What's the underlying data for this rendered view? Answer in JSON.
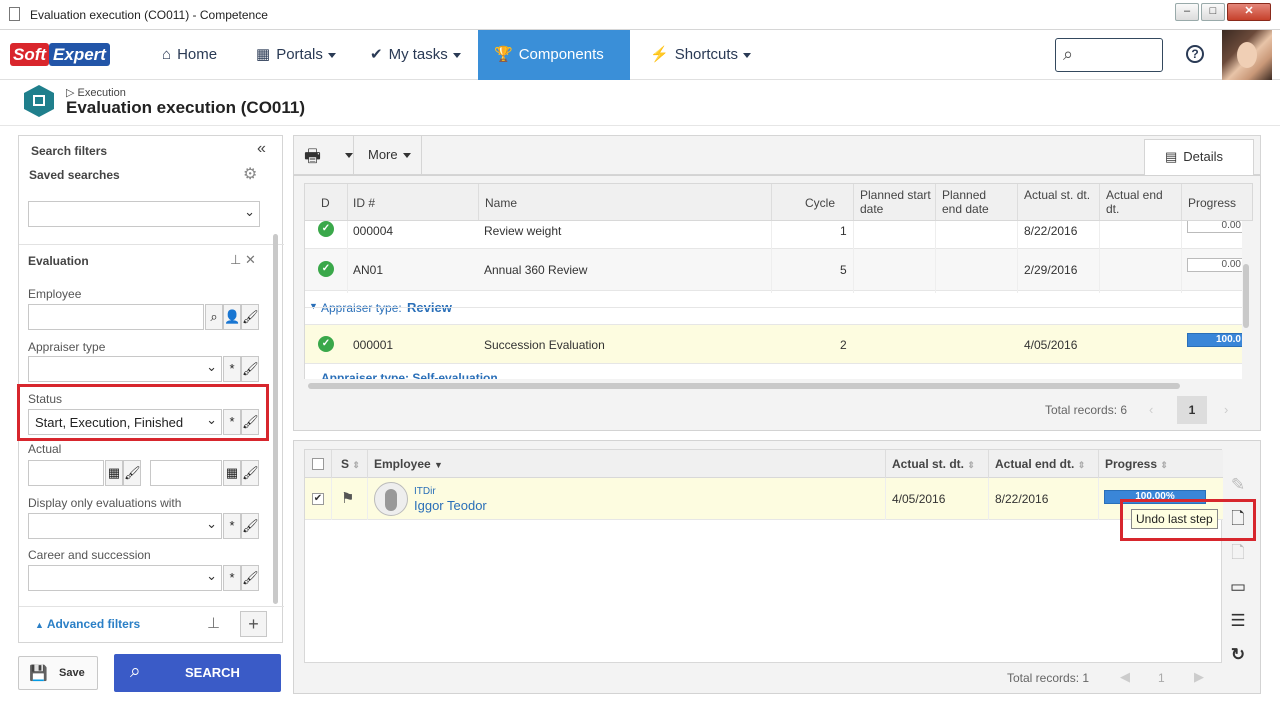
{
  "window": {
    "title": "Evaluation execution (CO011) - Competence",
    "min": "–",
    "max": "□",
    "close": "✕"
  },
  "nav": {
    "logo_left": "Soft",
    "logo_right": "Expert",
    "home": "Home",
    "portals": "Portals",
    "mytasks": "My tasks",
    "components": "Components",
    "shortcuts": "Shortcuts",
    "search_placeholder": "",
    "help": "?"
  },
  "header": {
    "crumb": "Execution",
    "title": "Evaluation execution (CO011)"
  },
  "filters": {
    "title": "Search filters",
    "saved_searches": "Saved searches",
    "saved_value": "",
    "evaluation": "Evaluation",
    "employee": "Employee",
    "appraiser_type": "Appraiser type",
    "status": "Status",
    "status_value": "Start, Execution, Finished",
    "actual": "Actual",
    "display_only": "Display only evaluations with",
    "career": "Career and succession",
    "advanced": "Advanced filters",
    "save": "Save",
    "search": "SEARCH"
  },
  "toolbar": {
    "more": "More",
    "details": "Details"
  },
  "top_grid": {
    "headers": [
      "D",
      "ID #",
      "Name",
      "Cycle",
      "Planned start date",
      "Planned end date",
      "Actual st. dt.",
      "Actual end dt.",
      "Progress"
    ],
    "rows": [
      {
        "id": "000004",
        "name": "Review weight",
        "cycle": "1",
        "actual_st": "8/22/2016",
        "progress": "0.00",
        "progress_value": 0
      },
      {
        "id": "AN01",
        "name": "Annual 360 Review",
        "cycle": "5",
        "actual_st": "2/29/2016",
        "progress": "0.00",
        "progress_value": 0
      }
    ],
    "group_label": "Appraiser type:",
    "group_value": "Review",
    "group_rows": [
      {
        "id": "000001",
        "name": "Succession Evaluation",
        "cycle": "2",
        "actual_st": "4/05/2016",
        "progress": "100.0",
        "progress_value": 100
      }
    ],
    "cut_group": "Appraiser type: Self-evaluation",
    "total": "Total records: 6",
    "page": "1"
  },
  "bottom_grid": {
    "headers": {
      "s": "S",
      "employee": "Employee",
      "actual_st": "Actual st. dt.",
      "actual_end": "Actual end dt.",
      "progress": "Progress"
    },
    "row": {
      "dept": "ITDir",
      "name": "Iggor Teodor",
      "actual_st": "4/05/2016",
      "actual_end": "8/22/2016",
      "progress": "100.00%",
      "progress_value": 100
    },
    "tooltip": "Undo last step",
    "total": "Total records: 1",
    "page": "1"
  },
  "colors": {
    "accent": "#3a8fd8",
    "search_btn": "#3a5bc7",
    "highlight_row": "#fdfce0",
    "red_box": "#d7262d"
  }
}
